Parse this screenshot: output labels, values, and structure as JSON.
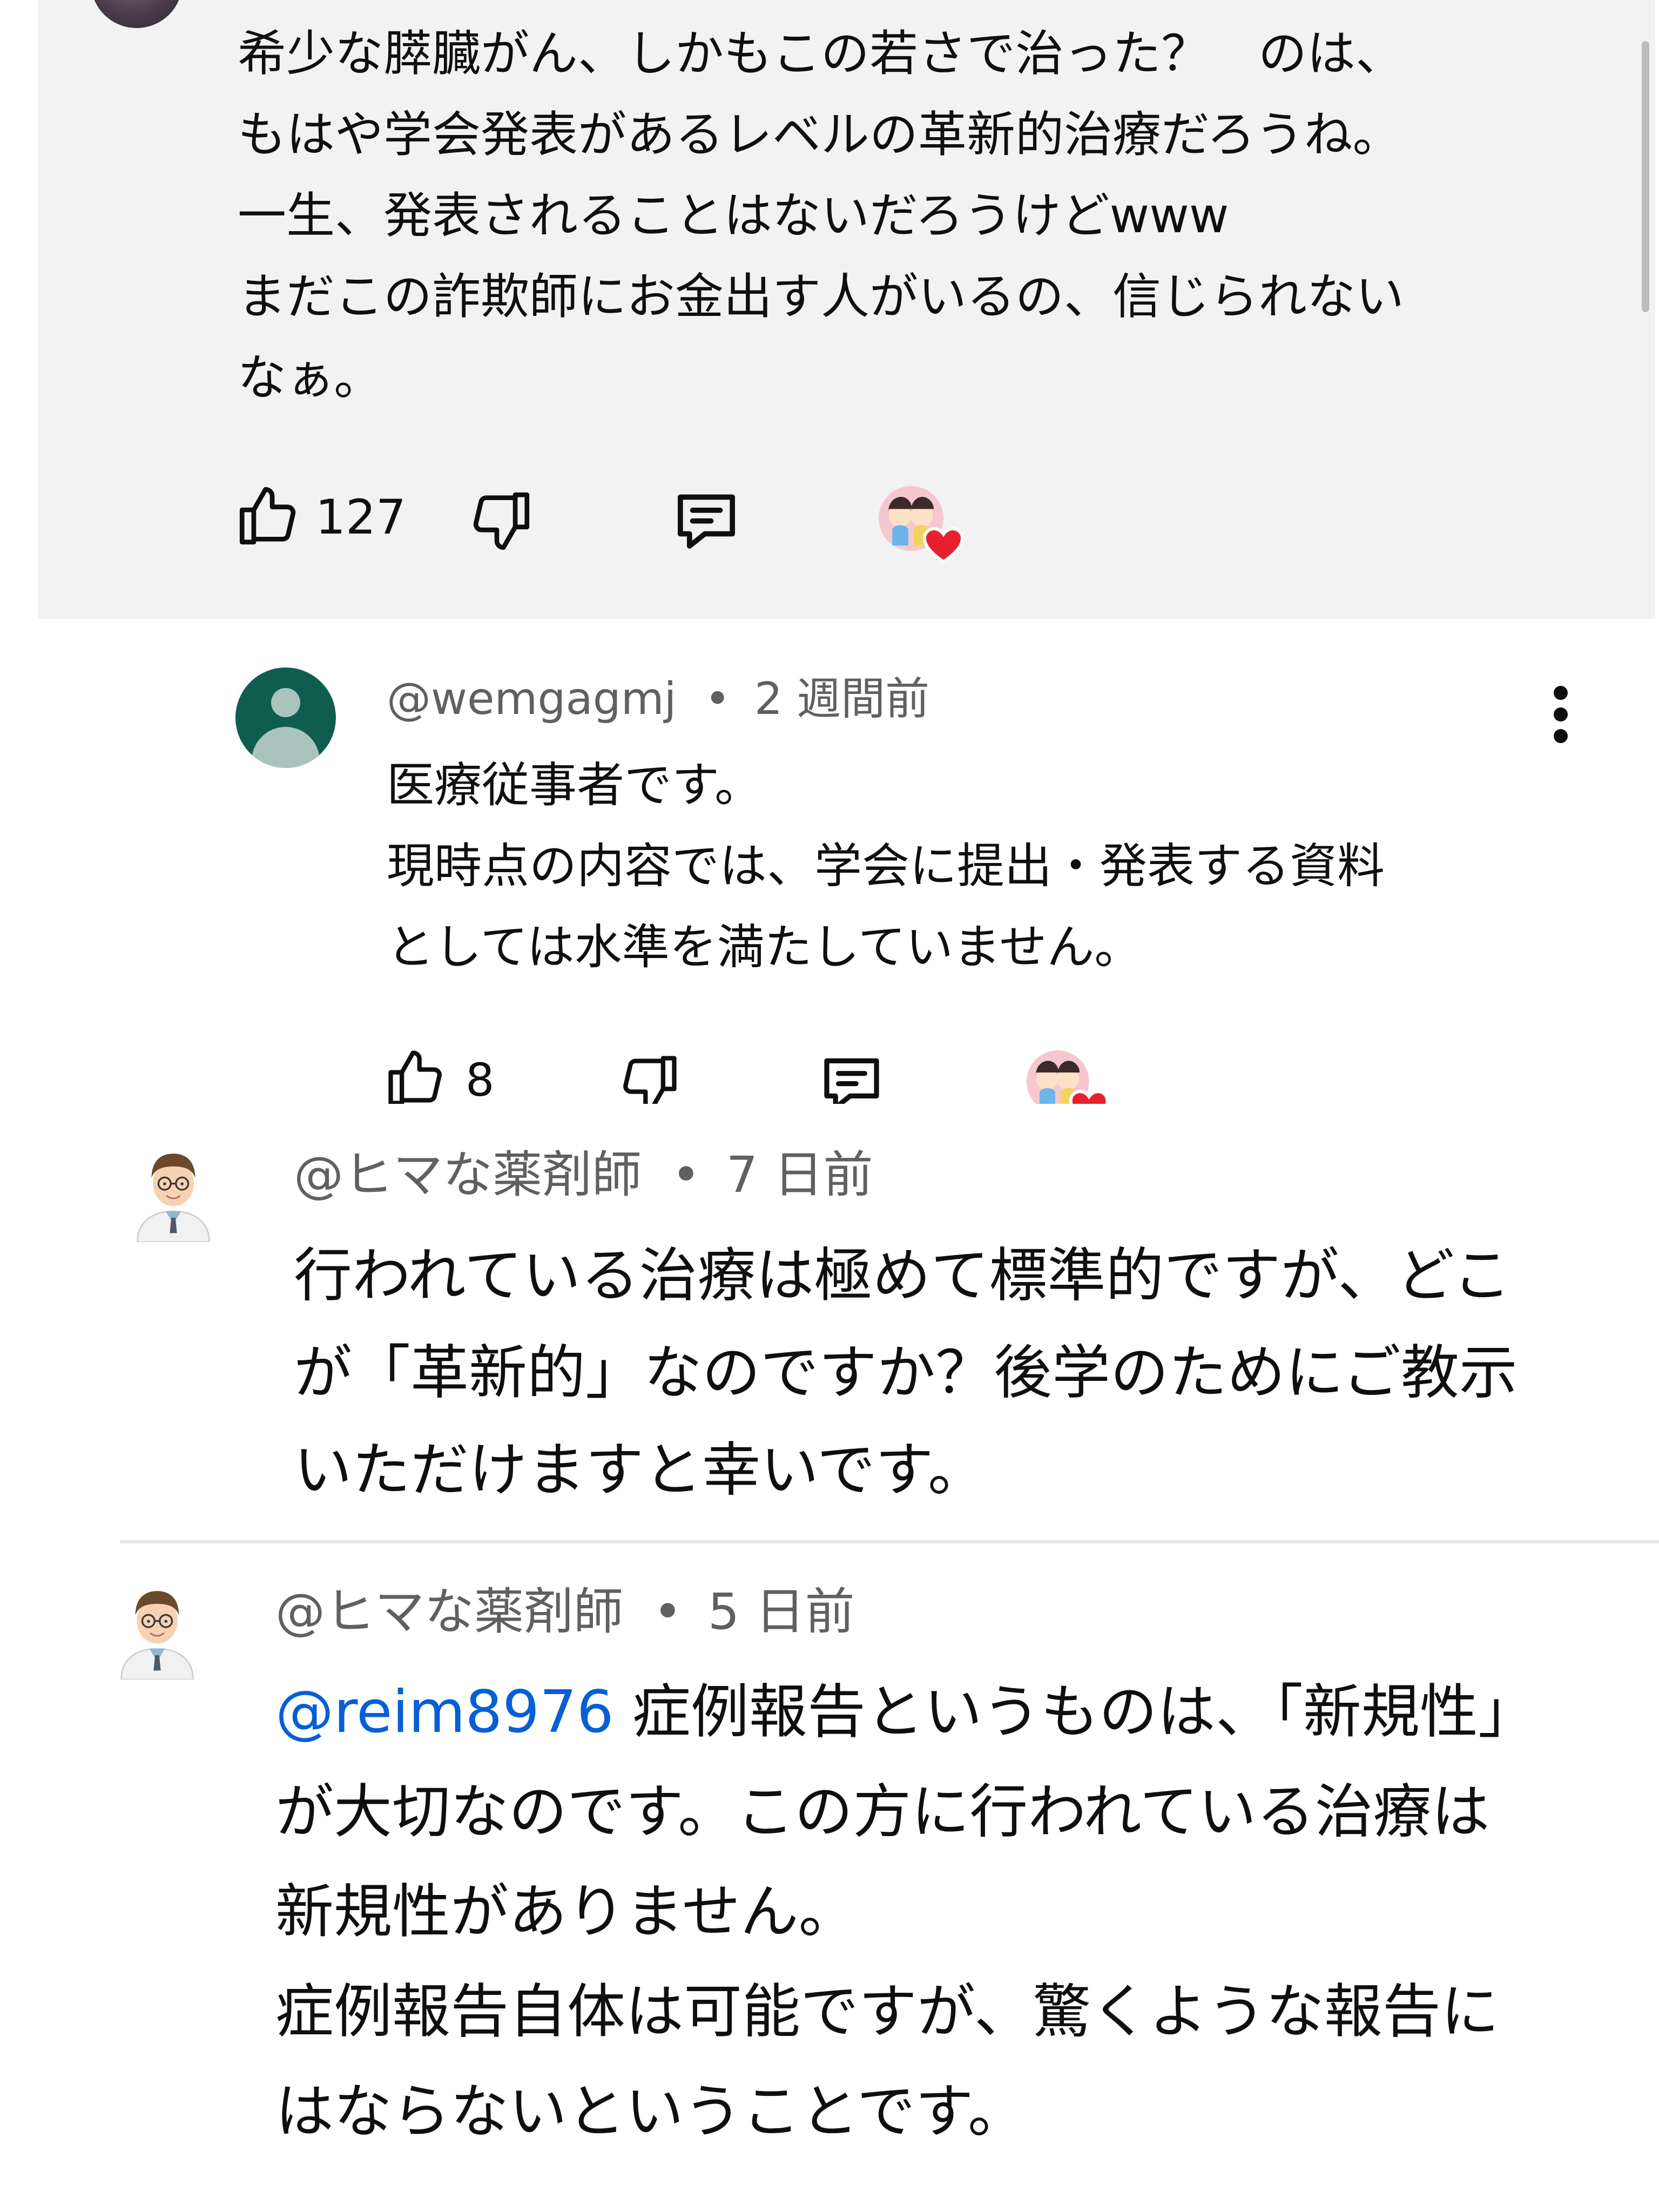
{
  "comment_1": {
    "lines": [
      "希少な膵臓がん、しかもこの若さで治った？　のは、",
      "もはや学会発表があるレベルの革新的治療だろうね。",
      "一生、発表されることはないだろうけどwww",
      "まだこの詐欺師にお金出す人がいるの、信じられない",
      "なぁ。"
    ],
    "like_count": "127",
    "like_icon": "thumbs-up-icon",
    "dislike_icon": "thumbs-down-icon",
    "reply_icon": "reply-comment-icon",
    "creator_heart_icon": "creator-heart-icon"
  },
  "reply_1": {
    "author": "@wemgagmj",
    "separator": "•",
    "time": "2 週間前",
    "lines": [
      "医療従事者です。",
      "現時点の内容では、学会に提出・発表する資料",
      "としては水準を満たしていません。"
    ],
    "like_count": "8",
    "menu_icon": "more-vertical-icon"
  },
  "reply_2": {
    "author": "@ヒマな薬剤師",
    "separator": "•",
    "time": "7 日前",
    "lines": [
      "行われている治療は極めて標準的ですが、どこ",
      "が「革新的」なのですか？後学のためにご教示",
      "いただけますと幸いです。"
    ]
  },
  "reply_3": {
    "author": "@ヒマな薬剤師",
    "separator": "•",
    "time": "5 日前",
    "mention": "@reim8976",
    "first_line_rest": " 症例報告というものは、「新規性」",
    "lines": [
      "が大切なのです。この方に行われている治療は",
      "新規性がありません。",
      "症例報告自体は可能ですが、驚くような報告に",
      "はならないということです。"
    ]
  },
  "colors": {
    "highlight_background": "#f2f2f2",
    "mention_link": "#065fd4",
    "meta_text": "#606060",
    "default_avatar": "#0f5d4e",
    "heart": "#e8202e"
  }
}
